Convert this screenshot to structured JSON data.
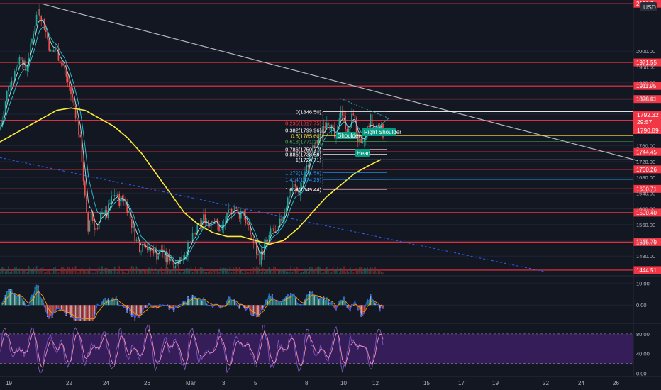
{
  "currency": "USD",
  "colors": {
    "background": "#131722",
    "grid": "#1f2433",
    "level_line": "#f23645",
    "price_label_bg": "#f23645",
    "ma_yellow": "#ffeb3b",
    "candle_up": "#26a69a",
    "candle_down": "#ef5350",
    "trendline": "#b2b5be",
    "dotted_trend": "#2962ff",
    "fib": "#ffffff",
    "pattern_label_bg": "#089981",
    "macd_line": "#2962ff",
    "signal_line": "#ff9800",
    "stoch_fill": "#3b1f63",
    "stoch_k": "#7e57c2",
    "stoch_d": "#f48fb1"
  },
  "chart_data": [
    {
      "type": "candlestick",
      "pair_quote": "USD",
      "ylim": [
        1430,
        2130
      ],
      "y_ticks": [
        1480,
        1520,
        1560,
        1600,
        1640,
        1680,
        1720,
        1760,
        1800,
        1840,
        1880,
        1920,
        1960,
        2000
      ],
      "x_ticks": [
        "19",
        "22",
        "24",
        "26",
        "Mar",
        "3",
        "5",
        "8",
        "10",
        "12",
        "15",
        "17",
        "19",
        "22",
        "24",
        "26"
      ],
      "price_levels": [
        2120.7,
        1971.55,
        1911.95,
        1878.61,
        1824.48,
        1744.45,
        1700.26,
        1650.71,
        1590.4,
        1515.79,
        1444.51
      ],
      "price_level_labels": [
        "2120.7",
        "1971.55",
        "1911.95",
        "1878.61",
        "1824.48",
        "1744.45",
        "1700.26",
        "1650.71",
        "1590.40",
        "1515.79",
        "1444.51"
      ],
      "current_price": "1792.32",
      "countdown": "29:57",
      "secondary_price": "1790.89",
      "fib_levels": [
        {
          "label": "0(1846.50)",
          "price": 1846.5,
          "color": "#ffffff"
        },
        {
          "label": "0.236(1817.75)",
          "price": 1817.75,
          "color": "#f23645"
        },
        {
          "label": "0.382(1799.96)",
          "price": 1799.96,
          "color": "#ffffff"
        },
        {
          "label": "0.5(1785.60)",
          "price": 1785.6,
          "color": "#ffeb3b"
        },
        {
          "label": "0.618(1771.23)",
          "price": 1771.23,
          "color": "#4caf50"
        },
        {
          "label": "0.786(1750.77)",
          "price": 1750.77,
          "color": "#ffffff"
        },
        {
          "label": "0.886(1738.59)",
          "price": 1738.59,
          "color": "#ffffff"
        },
        {
          "label": "1(1724.71)",
          "price": 1724.71,
          "color": "#ffffff"
        },
        {
          "label": "1.272(1691.58)",
          "price": 1691.58,
          "color": "#2196f3"
        },
        {
          "label": "1.414(1674.29)",
          "price": 1674.29,
          "color": "#2196f3"
        },
        {
          "label": "1.618(1649.44)",
          "price": 1649.44,
          "color": "#ffffff"
        }
      ],
      "pattern_labels": [
        "Shoulder",
        "Head",
        "Right Shoulder"
      ],
      "close_path": [
        [
          0,
          1800
        ],
        [
          6,
          1850
        ],
        [
          12,
          1920
        ],
        [
          18,
          1930
        ],
        [
          24,
          1970
        ],
        [
          30,
          1990
        ],
        [
          36,
          1950
        ],
        [
          42,
          2000
        ],
        [
          48,
          2060
        ],
        [
          54,
          2110
        ],
        [
          60,
          2080
        ],
        [
          66,
          2040
        ],
        [
          72,
          1990
        ],
        [
          78,
          2010
        ],
        [
          84,
          1980
        ],
        [
          90,
          1960
        ],
        [
          96,
          1920
        ],
        [
          102,
          1880
        ],
        [
          108,
          1830
        ],
        [
          114,
          1760
        ],
        [
          120,
          1620
        ],
        [
          124,
          1540
        ],
        [
          128,
          1600
        ],
        [
          132,
          1560
        ],
        [
          138,
          1540
        ],
        [
          144,
          1600
        ],
        [
          150,
          1580
        ],
        [
          156,
          1620
        ],
        [
          162,
          1640
        ],
        [
          168,
          1620
        ],
        [
          174,
          1630
        ],
        [
          180,
          1600
        ],
        [
          186,
          1560
        ],
        [
          192,
          1520
        ],
        [
          198,
          1500
        ],
        [
          204,
          1520
        ],
        [
          210,
          1490
        ],
        [
          216,
          1500
        ],
        [
          222,
          1480
        ],
        [
          228,
          1500
        ],
        [
          234,
          1470
        ],
        [
          240,
          1480
        ],
        [
          246,
          1460
        ],
        [
          252,
          1470
        ],
        [
          258,
          1480
        ],
        [
          264,
          1500
        ],
        [
          270,
          1520
        ],
        [
          276,
          1540
        ],
        [
          282,
          1560
        ],
        [
          288,
          1580
        ],
        [
          294,
          1560
        ],
        [
          300,
          1580
        ],
        [
          306,
          1560
        ],
        [
          312,
          1540
        ],
        [
          318,
          1570
        ],
        [
          324,
          1590
        ],
        [
          330,
          1610
        ],
        [
          336,
          1580
        ],
        [
          342,
          1600
        ],
        [
          348,
          1560
        ],
        [
          354,
          1530
        ],
        [
          360,
          1500
        ],
        [
          366,
          1470
        ],
        [
          372,
          1500
        ],
        [
          378,
          1520
        ],
        [
          384,
          1550
        ],
        [
          390,
          1530
        ],
        [
          396,
          1570
        ],
        [
          402,
          1600
        ],
        [
          408,
          1640
        ],
        [
          414,
          1660
        ],
        [
          420,
          1640
        ],
        [
          426,
          1660
        ],
        [
          432,
          1700
        ],
        [
          438,
          1740
        ],
        [
          444,
          1760
        ],
        [
          450,
          1780
        ],
        [
          456,
          1810
        ],
        [
          462,
          1830
        ],
        [
          468,
          1800
        ],
        [
          474,
          1770
        ],
        [
          480,
          1860
        ],
        [
          486,
          1820
        ],
        [
          492,
          1790
        ],
        [
          498,
          1850
        ],
        [
          504,
          1780
        ],
        [
          510,
          1750
        ],
        [
          516,
          1790
        ],
        [
          522,
          1830
        ],
        [
          528,
          1800
        ],
        [
          534,
          1820
        ],
        [
          540,
          1792
        ]
      ],
      "ma_path": [
        [
          0,
          1770
        ],
        [
          20,
          1790
        ],
        [
          40,
          1810
        ],
        [
          60,
          1830
        ],
        [
          80,
          1850
        ],
        [
          100,
          1856
        ],
        [
          120,
          1850
        ],
        [
          140,
          1830
        ],
        [
          160,
          1810
        ],
        [
          180,
          1780
        ],
        [
          200,
          1740
        ],
        [
          220,
          1690
        ],
        [
          240,
          1640
        ],
        [
          260,
          1590
        ],
        [
          280,
          1560
        ],
        [
          300,
          1540
        ],
        [
          320,
          1530
        ],
        [
          340,
          1530
        ],
        [
          360,
          1520
        ],
        [
          380,
          1510
        ],
        [
          400,
          1520
        ],
        [
          420,
          1550
        ],
        [
          440,
          1590
        ],
        [
          460,
          1630
        ],
        [
          480,
          1660
        ],
        [
          500,
          1690
        ],
        [
          520,
          1710
        ],
        [
          537,
          1725
        ]
      ],
      "trendline": [
        [
          60,
          2120
        ],
        [
          900,
          1722
        ]
      ],
      "dotted_trendline": [
        [
          0,
          1730
        ],
        [
          770,
          1440
        ]
      ]
    },
    {
      "type": "macd",
      "ylim": [
        -8,
        13
      ],
      "y_ticks": [
        10,
        0
      ],
      "y_tick_labels": [
        "10.00",
        "0.00"
      ]
    },
    {
      "type": "stochastic",
      "ylim": [
        -5,
        100
      ],
      "y_ticks": [
        80,
        40,
        0
      ],
      "y_tick_labels": [
        "80.00",
        "40.00",
        "0.00"
      ],
      "band": [
        20,
        80
      ]
    }
  ]
}
